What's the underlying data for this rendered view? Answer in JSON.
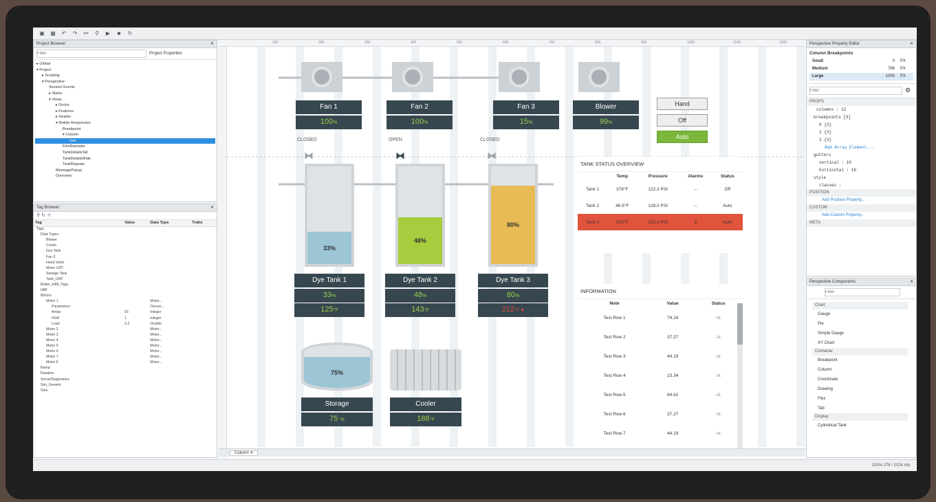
{
  "toolbar": {
    "icons": [
      "save-icon",
      "grid-icon",
      "undo-icon",
      "redo-icon",
      "link-icon",
      "filter-icon",
      "play-icon",
      "stop-icon",
      "refresh-icon"
    ]
  },
  "project_browser": {
    "title": "Project Browser",
    "filter_placeholder": "Filter",
    "props_button": "Project Properties",
    "items": [
      "Global",
      "Project",
      "Scripting",
      "Perspective",
      "Session Events",
      "Styles",
      "Views",
      "Docks",
      "Features",
      "Header",
      "Mobile Responsive",
      "Breakpoint",
      "Column",
      "root",
      "FlexRepeater",
      "TankDetailsTall",
      "TankDetailsWide",
      "TankRepeats",
      "MessagePopup",
      "Overview"
    ]
  },
  "tag_browser": {
    "title": "Tag Browser",
    "columns": [
      "Tag",
      "Value",
      "Data Type",
      "Traits"
    ],
    "rows": [
      [
        "Tags",
        "",
        "",
        ""
      ],
      [
        "Data Types",
        "",
        "",
        ""
      ],
      [
        "Blower",
        "",
        "",
        ""
      ],
      [
        "Cooler",
        "",
        "",
        ""
      ],
      [
        "Dye Tank",
        "",
        "",
        ""
      ],
      [
        "Fan 3",
        "",
        "",
        ""
      ],
      [
        "Hand Valve",
        "",
        "",
        ""
      ],
      [
        "Motor UDT",
        "",
        "",
        ""
      ],
      [
        "Storage Tank",
        "",
        "",
        ""
      ],
      [
        "Tank_UDF",
        "",
        "",
        ""
      ],
      [
        "Better_HMI_Tags",
        "",
        "",
        ""
      ],
      [
        "HMI",
        "",
        "",
        ""
      ],
      [
        "Motors",
        "",
        "",
        ""
      ],
      [
        "Motor 1",
        "",
        "Motor...",
        ""
      ],
      [
        "Parameters",
        "",
        "Docum...",
        ""
      ],
      [
        "Amps",
        "55",
        "Integer",
        ""
      ],
      [
        "HOA",
        "1",
        "Integer",
        ""
      ],
      [
        "Load",
        "3.2",
        "Double",
        ""
      ],
      [
        "Motor 2",
        "",
        "Motor...",
        ""
      ],
      [
        "Motor 3",
        "",
        "Motor...",
        ""
      ],
      [
        "Motor 4",
        "",
        "Motor...",
        ""
      ],
      [
        "Motor 5",
        "",
        "Motor...",
        ""
      ],
      [
        "Motor 6",
        "",
        "Motor...",
        ""
      ],
      [
        "Motor 7",
        "",
        "Motor...",
        ""
      ],
      [
        "Motor 8",
        "",
        "Motor...",
        ""
      ],
      [
        "Ramp",
        "",
        "",
        ""
      ],
      [
        "Random",
        "",
        "",
        ""
      ],
      [
        "ServerDiagnostics",
        "",
        "",
        ""
      ],
      [
        "Sim_Generic",
        "",
        "",
        ""
      ],
      [
        "Sine",
        "",
        "",
        ""
      ]
    ]
  },
  "ruler": [
    "100",
    "200",
    "300",
    "400",
    "500",
    "600",
    "700",
    "800",
    "900",
    "1000",
    "1100",
    "1200"
  ],
  "fans": [
    {
      "name": "Fan 1",
      "value": "100",
      "unit": "%"
    },
    {
      "name": "Fan 2",
      "value": "100",
      "unit": "%"
    },
    {
      "name": "Fan 3",
      "value": "15",
      "unit": "%"
    },
    {
      "name": "Blower",
      "value": "99",
      "unit": "%"
    }
  ],
  "hoa": {
    "hand": "Hand",
    "off": "Off",
    "auto": "Auto"
  },
  "valves": [
    "CLOSED",
    "OPEN",
    "CLOSED"
  ],
  "tanks": [
    {
      "name": "Dye Tank 1",
      "level": "33%",
      "pct": "33",
      "temp": "125",
      "unit": "°F",
      "fill_color": "#9cc5d6"
    },
    {
      "name": "Dye Tank 2",
      "level": "48%",
      "pct": "48",
      "temp": "143",
      "unit": "°F",
      "fill_color": "#a7cc3d"
    },
    {
      "name": "Dye Tank 3",
      "level": "80%",
      "pct": "80",
      "temp": "212",
      "unit": "°F",
      "fill_color": "#e8bb55"
    }
  ],
  "storage": {
    "name": "Storage",
    "level": "75%",
    "value": "75",
    "unit": "%"
  },
  "cooler": {
    "name": "Cooler",
    "value": "188",
    "unit": "°F"
  },
  "tank_status": {
    "title": "TANK STATUS OVERVIEW",
    "columns": [
      "",
      "Temp",
      "Pressure",
      "Alarms",
      "Status"
    ],
    "rows": [
      [
        "Tank 1",
        "378°F",
        "122.3 PSI",
        "--",
        "Off"
      ],
      [
        "Tank 2",
        "46.9°F",
        "128.0 PSI",
        "--",
        "Auto"
      ],
      [
        "Tank 3",
        "378°F",
        "122.3 PSI",
        "3",
        "Auto"
      ]
    ]
  },
  "information": {
    "title": "INFORMATION",
    "columns": [
      "Note",
      "Value",
      "Status"
    ],
    "rows": [
      [
        "Test Row 1",
        "74.24",
        "ok"
      ],
      [
        "Test Row 2",
        "37.27",
        "ok"
      ],
      [
        "Test Row 3",
        "44.19",
        "ok"
      ],
      [
        "Test Row 4",
        "23.34",
        "ok"
      ],
      [
        "Test Row 5",
        "94.62",
        "ok"
      ],
      [
        "Test Row 6",
        "37.27",
        "ok"
      ],
      [
        "Test Row 7",
        "44.19",
        "ok"
      ]
    ]
  },
  "bottom_tab": "Column",
  "property_editor": {
    "title": "Perspective Property Editor",
    "breakpoints_title": "Column Breakpoints",
    "breakpoints": [
      [
        "Small",
        "0",
        "PX"
      ],
      [
        "Medium",
        "768",
        "PX"
      ],
      [
        "Large",
        "1000",
        "PX"
      ]
    ],
    "filter_placeholder": "Filter",
    "props_header": "PROPS",
    "props": [
      "columns : 12",
      "breakpoints [3]",
      "0 {3}",
      "1 {3}",
      "2 {3}",
      "Add Array Element...",
      "gutters",
      "vertical : 10",
      "horizontal : 10",
      "style",
      "classes :"
    ],
    "position_header": "POSITION",
    "position_add": "Add Position Property...",
    "custom_header": "CUSTOM",
    "custom_add": "Add Custom Property...",
    "meta_header": "META"
  },
  "components": {
    "title": "Perspective Components",
    "filter_placeholder": "Filter",
    "groups": [
      {
        "name": "Chart",
        "items": [
          "Gauge",
          "Pie",
          "Simple Gauge",
          "XY Chart"
        ]
      },
      {
        "name": "Container",
        "items": [
          "Breakpoint",
          "Column",
          "Coordinate",
          "Drawing",
          "Flex",
          "Tab"
        ]
      },
      {
        "name": "Display",
        "items": [
          "Cylindrical Tank"
        ]
      }
    ]
  },
  "status_text": "100% 278 / 1024 mb"
}
